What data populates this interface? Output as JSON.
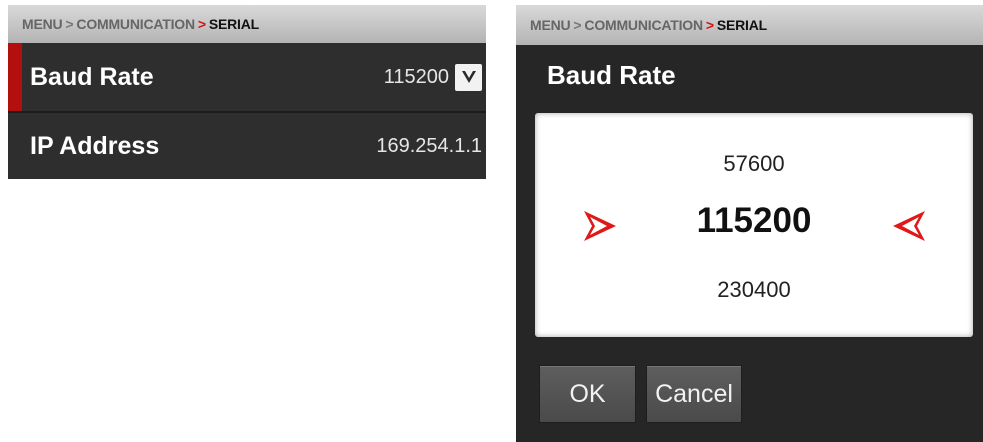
{
  "breadcrumb": {
    "root": "MENU",
    "sep": ">",
    "parent": "COMMUNICATION",
    "arrow": ">",
    "current": "SERIAL"
  },
  "settings": {
    "baud_label": "Baud Rate",
    "baud_value": "115200",
    "ip_label": "IP Address",
    "ip_value": "169.254.1.1"
  },
  "dialog": {
    "title": "Baud Rate",
    "options": {
      "prev": "57600",
      "selected": "115200",
      "next": "230400"
    },
    "ok_label": "OK",
    "cancel_label": "Cancel"
  },
  "icons": {
    "dropdown": "chevron-down-icon",
    "picker_left": "arrow-right-icon",
    "picker_right": "arrow-left-icon"
  },
  "colors": {
    "accent_red": "#d41414",
    "selected_bar": "#b30f0f",
    "panel_bg": "#2c2c2c",
    "dialog_bg": "#262626"
  }
}
